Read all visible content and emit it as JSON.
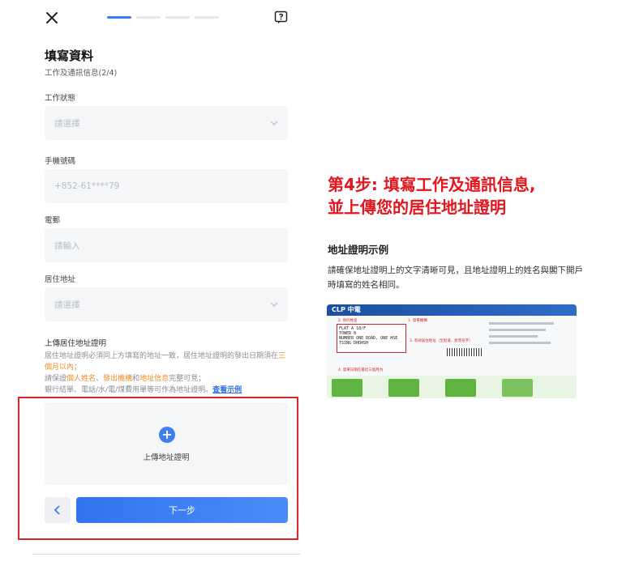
{
  "topbar": {
    "close_icon": "close-icon",
    "help_icon": "help-icon",
    "progress_total": 4,
    "progress_current": 1
  },
  "form": {
    "title": "填寫資料",
    "subtitle": "工作及通訊信息(2/4)",
    "fields": {
      "work_status": {
        "label": "工作狀態",
        "placeholder": "請選擇"
      },
      "phone": {
        "label": "手機號碼",
        "value": "+852-61****79"
      },
      "email": {
        "label": "電郵",
        "placeholder": "請輸入"
      },
      "address": {
        "label": "居住地址",
        "placeholder": "請選擇"
      }
    },
    "upload": {
      "title": "上傳居住地址證明",
      "desc_1": "居住地址證明必須同上方填寫的地址一致，居住地址證明的發出日期須在",
      "desc_highlight_1": "三個月以內",
      "desc_2": "；",
      "desc_3": "請保證",
      "desc_highlight_2": "個人姓名",
      "desc_sep_1": "、",
      "desc_highlight_3": "發出機構",
      "desc_sep_2": "和",
      "desc_highlight_4": "地址信息",
      "desc_4": "完整可見；",
      "desc_5": "銀行結單、電話/水/電/煤費用單等可作為地址證明。",
      "link": "查看示例",
      "box_label": "上傳地址證明"
    },
    "next_label": "下一步"
  },
  "annotation": {
    "line_1": "第4步: 填寫工作及通訊信息,",
    "line_2": "並上傳您的居住地址證明",
    "color": "#e4151d"
  },
  "sample": {
    "title": "地址證明示例",
    "desc": "請確保地址證明上的文字清晰可見，且地址證明上的姓名與閣下開戶時填寫的姓名相同。",
    "bill": {
      "logo": "CLP 中電",
      "box_lines": [
        "FLAT A 18/F",
        "TOWER 8",
        "NUMBER ONE ROAD, ONE HSE",
        "TSING DHDHSH"
      ],
      "note_1": "1. 發單機構",
      "note_2": "2. 你的姓名",
      "note_3": "3. 有效居住地址（至街道、屋苑名字）",
      "note_4": "4. 發單日期在最近三個月內"
    }
  },
  "colors": {
    "accent": "#3d7ef5",
    "highlight": "#f08a24",
    "frame": "#d6252b"
  }
}
